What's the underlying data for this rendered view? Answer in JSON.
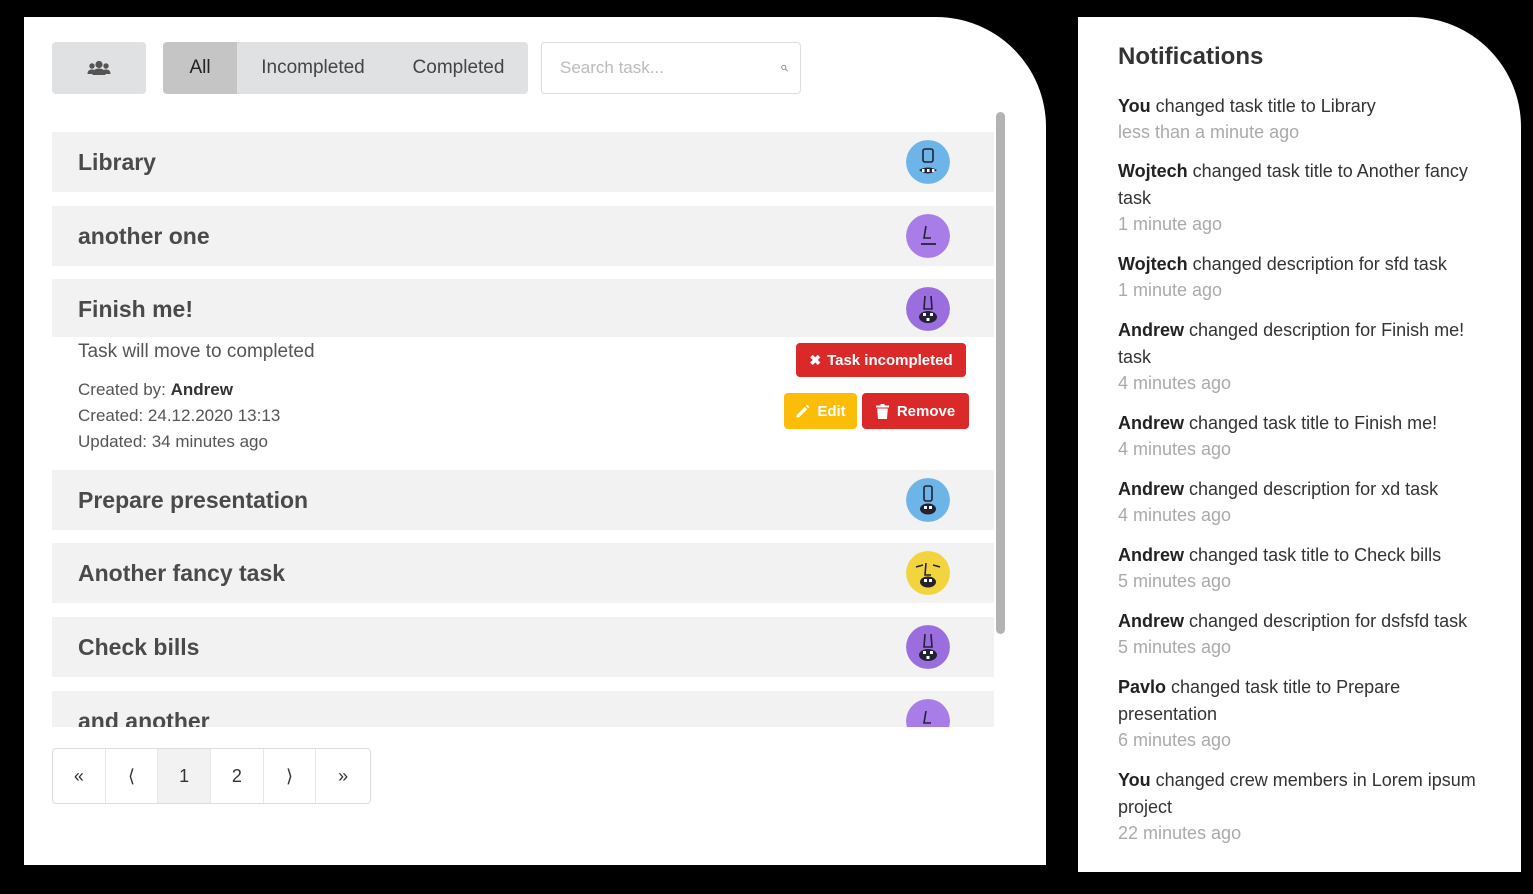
{
  "toolbar": {
    "crew_icon": "users-icon",
    "filters": [
      "All",
      "Incompleted",
      "Completed"
    ],
    "active_filter": "All",
    "search_placeholder": "Search task...",
    "search_icon": "search-icon"
  },
  "tasks": [
    {
      "title": "Library",
      "avatar_color": "#6db5e8"
    },
    {
      "title": "another one",
      "avatar_color": "#a87de8"
    },
    {
      "title": "Finish me!",
      "avatar_color": "#9b6ee0"
    },
    {
      "title": "Prepare presentation",
      "avatar_color": "#6db5e8"
    },
    {
      "title": "Another fancy task",
      "avatar_color": "#f2d43c"
    },
    {
      "title": "Check bills",
      "avatar_color": "#9b6ee0"
    },
    {
      "title": "and another",
      "avatar_color": "#a87de8"
    }
  ],
  "expanded_task": {
    "description": "Task will move to completed",
    "created_by_label": "Created by: ",
    "created_by": "Andrew",
    "created": "Created: 24.12.2020 13:13",
    "updated": "Updated: 34 minutes ago",
    "incomplete_label": "Task incompleted",
    "edit_label": "Edit",
    "remove_label": "Remove"
  },
  "pagination": {
    "first": "«",
    "prev": "⟨",
    "pages": [
      "1",
      "2"
    ],
    "active_page": "1",
    "next": "⟩",
    "last": "»"
  },
  "notifications": {
    "title": "Notifications",
    "items": [
      {
        "user": "You",
        "text": " changed task title to Library",
        "time": "less than a minute ago"
      },
      {
        "user": "Wojtech",
        "text": " changed task title to Another fancy task",
        "time": "1 minute ago"
      },
      {
        "user": "Wojtech",
        "text": " changed description for sfd task",
        "time": "1 minute ago"
      },
      {
        "user": "Andrew",
        "text": " changed description for Finish me! task",
        "time": "4 minutes ago"
      },
      {
        "user": "Andrew",
        "text": " changed task title to Finish me!",
        "time": "4 minutes ago"
      },
      {
        "user": "Andrew",
        "text": " changed description for xd task",
        "time": "4 minutes ago"
      },
      {
        "user": "Andrew",
        "text": " changed task title to Check bills",
        "time": "5 minutes ago"
      },
      {
        "user": "Andrew",
        "text": " changed description for dsfsfd task",
        "time": "5 minutes ago"
      },
      {
        "user": "Pavlo",
        "text": " changed task title to Prepare presentation",
        "time": "6 minutes ago"
      },
      {
        "user": "You",
        "text": " changed crew members in Lorem ipsum project",
        "time": "22 minutes ago"
      }
    ]
  }
}
